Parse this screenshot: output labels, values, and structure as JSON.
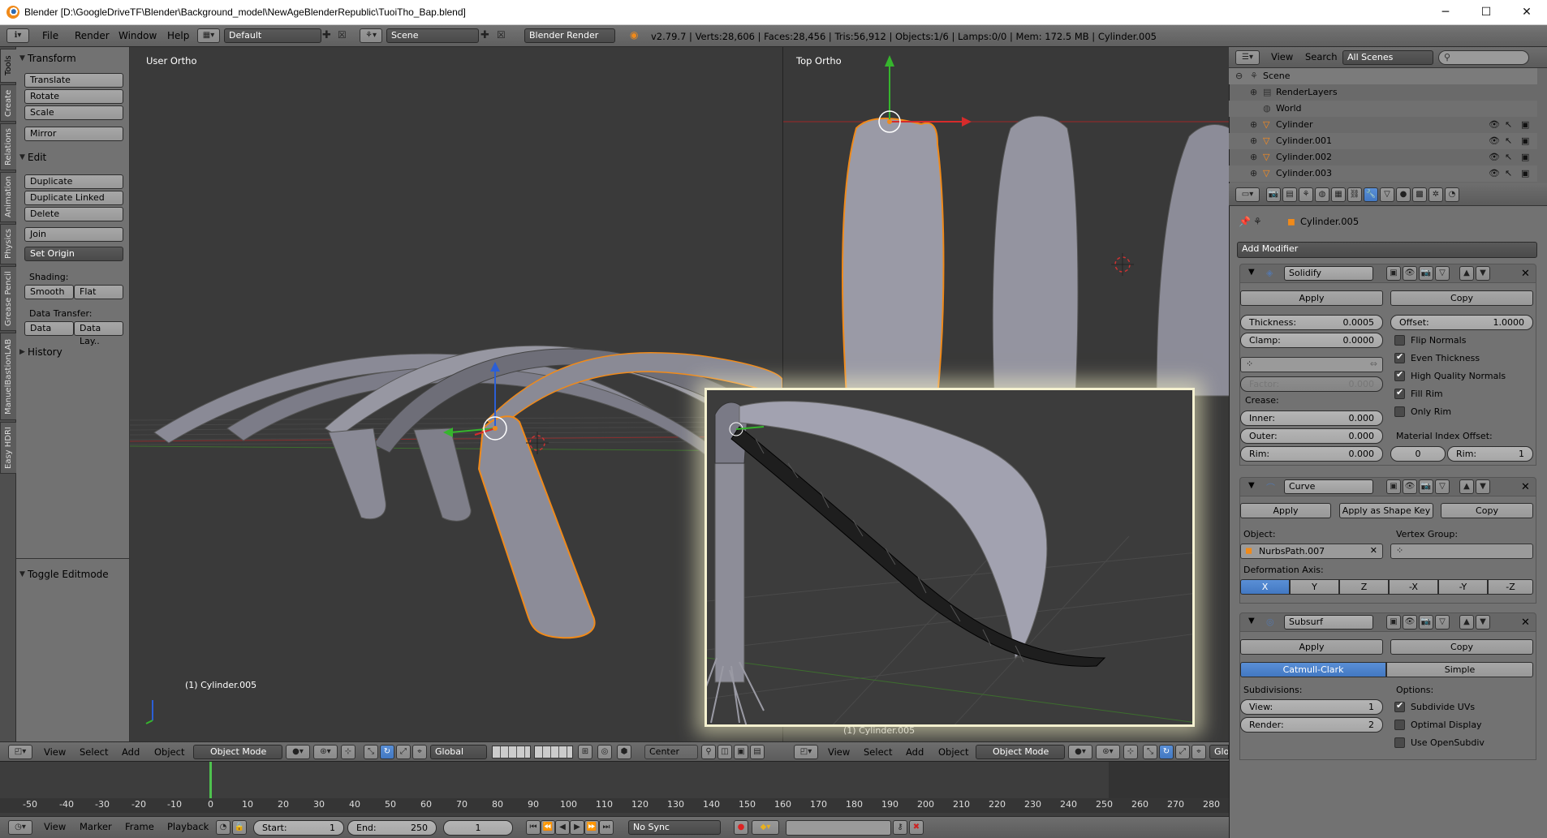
{
  "window": {
    "title": "Blender [D:\\GoogleDriveTF\\Blender\\Background_model\\NewAgeBlenderRepublic\\TuoiTho_Bap.blend]",
    "minimize": "─",
    "maximize": "☐",
    "close": "✕"
  },
  "info": {
    "menus": [
      "File",
      "Render",
      "Window",
      "Help"
    ],
    "layout": "Default",
    "scene": "Scene",
    "engine": "Blender Render",
    "stats": "v2.79.7 | Verts:28,606 | Faces:28,456 | Tris:56,912 | Objects:1/6 | Lamps:0/0 | Mem: 172.5 MB | Cylinder.005"
  },
  "tabs": [
    "Tools",
    "Create",
    "Relations",
    "Animation",
    "Physics",
    "Grease Pencil",
    "ManuelBastionLAB",
    "Easy HDRI"
  ],
  "toolshelf": {
    "transform_title": "Transform",
    "transform_buttons": [
      "Translate",
      "Rotate",
      "Scale",
      "Mirror"
    ],
    "edit_title": "Edit",
    "edit_buttons": [
      "Duplicate",
      "Duplicate Linked",
      "Delete",
      "Join",
      "Set Origin"
    ],
    "shading_label": "Shading:",
    "smooth": "Smooth",
    "flat": "Flat",
    "data_transfer_label": "Data Transfer:",
    "data": "Data",
    "data_lay": "Data Lay..",
    "history_title": "History",
    "toggle_editmode": "Toggle Editmode"
  },
  "viewport_left": {
    "label": "User Ortho",
    "object_label": "(1) Cylinder.005"
  },
  "viewport_right": {
    "label": "Top Ortho",
    "object_label": "(1) Cylinder.005"
  },
  "view_header": {
    "menus": [
      "View",
      "Select",
      "Add",
      "Object"
    ],
    "mode": "Object Mode",
    "orientation": "Global",
    "pivot": "Center"
  },
  "view_header_right": {
    "menus": [
      "View",
      "Select",
      "Add",
      "Object"
    ],
    "mode": "Object Mode",
    "orientation_cut": "Glo"
  },
  "timeline": {
    "ticks": [
      "-50",
      "-40",
      "-30",
      "-20",
      "-10",
      "0",
      "10",
      "20",
      "30",
      "40",
      "50",
      "60",
      "70",
      "80",
      "90",
      "100",
      "110",
      "120",
      "130",
      "140",
      "150",
      "160",
      "170",
      "180",
      "190",
      "200",
      "210",
      "220",
      "230",
      "240",
      "250",
      "260",
      "270",
      "280"
    ],
    "menus": [
      "View",
      "Marker",
      "Frame",
      "Playback"
    ],
    "start_label": "Start:",
    "start": "1",
    "end_label": "End:",
    "end": "250",
    "current": "1",
    "sync": "No Sync"
  },
  "outliner": {
    "menus": [
      "View",
      "Search"
    ],
    "filter": "All Scenes",
    "rows": [
      "Scene",
      "RenderLayers",
      "World",
      "Cylinder",
      "Cylinder.001",
      "Cylinder.002",
      "Cylinder.003"
    ]
  },
  "properties": {
    "object_name": "Cylinder.005",
    "add_modifier": "Add Modifier",
    "solidify": {
      "name": "Solidify",
      "apply": "Apply",
      "copy": "Copy",
      "thickness_label": "Thickness:",
      "thickness": "0.0005",
      "offset_label": "Offset:",
      "offset": "1.0000",
      "clamp_label": "Clamp:",
      "clamp": "0.0000",
      "flip_normals": "Flip Normals",
      "even_thickness": "Even Thickness",
      "high_quality_normals": "High Quality Normals",
      "fill_rim": "Fill Rim",
      "only_rim": "Only Rim",
      "factor_label": "Factor:",
      "factor": "0.000",
      "crease_label": "Crease:",
      "inner_label": "Inner:",
      "inner": "0.000",
      "outer_label": "Outer:",
      "outer": "0.000",
      "rim_label": "Rim:",
      "rim": "0.000",
      "material_index_offset": "Material Index Offset:",
      "mat_offset": "0",
      "mat_rim_label": "Rim:",
      "mat_rim": "1"
    },
    "curve": {
      "name": "Curve",
      "apply": "Apply",
      "apply_shape": "Apply as Shape Key",
      "copy": "Copy",
      "object_label": "Object:",
      "object": "NurbsPath.007",
      "vertex_group_label": "Vertex Group:",
      "deform_axis_label": "Deformation Axis:",
      "axes": [
        "X",
        "Y",
        "Z",
        "-X",
        "-Y",
        "-Z"
      ]
    },
    "subsurf": {
      "name": "Subsurf",
      "apply": "Apply",
      "copy": "Copy",
      "catmull": "Catmull-Clark",
      "simple": "Simple",
      "subdivisions_label": "Subdivisions:",
      "view_label": "View:",
      "view": "1",
      "render_label": "Render:",
      "render": "2",
      "options_label": "Options:",
      "subdivide_uvs": "Subdivide UVs",
      "optimal_display": "Optimal Display",
      "use_opensubdiv": "Use OpenSubdiv"
    }
  }
}
